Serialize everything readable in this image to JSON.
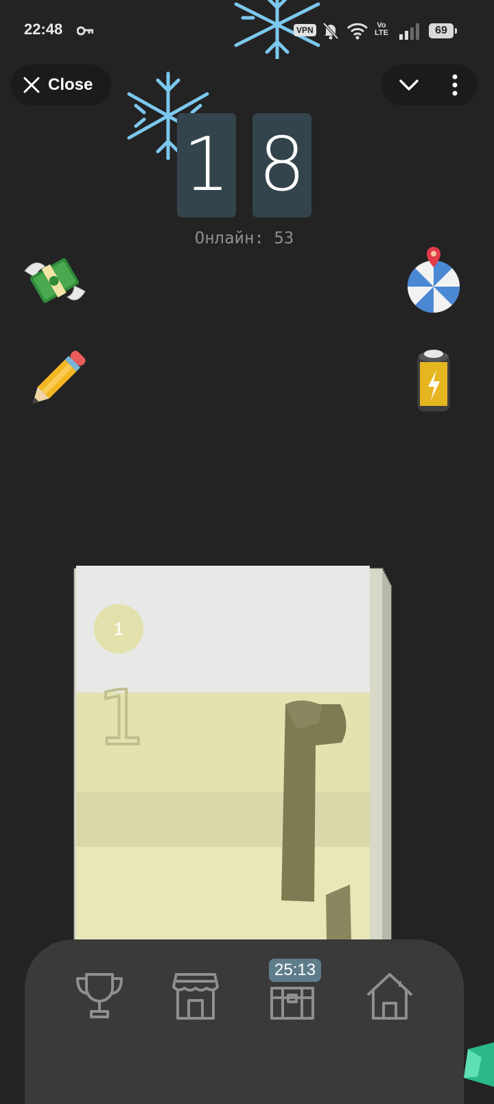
{
  "status_bar": {
    "time": "22:48",
    "vpn": "VPN",
    "volte_top": "Vo",
    "volte_bottom": "LTE",
    "battery": "69"
  },
  "toolbar": {
    "close_label": "Close"
  },
  "counter": {
    "digit_1": "1",
    "digit_2": "8",
    "online_text": "Онлайн: 53"
  },
  "deck": {
    "badge_number": "1"
  },
  "bottom_nav": {
    "timer": "25:13",
    "items": [
      "trophy-icon",
      "shop-icon",
      "chest-icon",
      "home-icon"
    ]
  },
  "colors": {
    "background": "#232323",
    "flip_card": "#34444c",
    "nav_bar": "#3a3a3a",
    "timer_badge": "#5e7d8a"
  }
}
